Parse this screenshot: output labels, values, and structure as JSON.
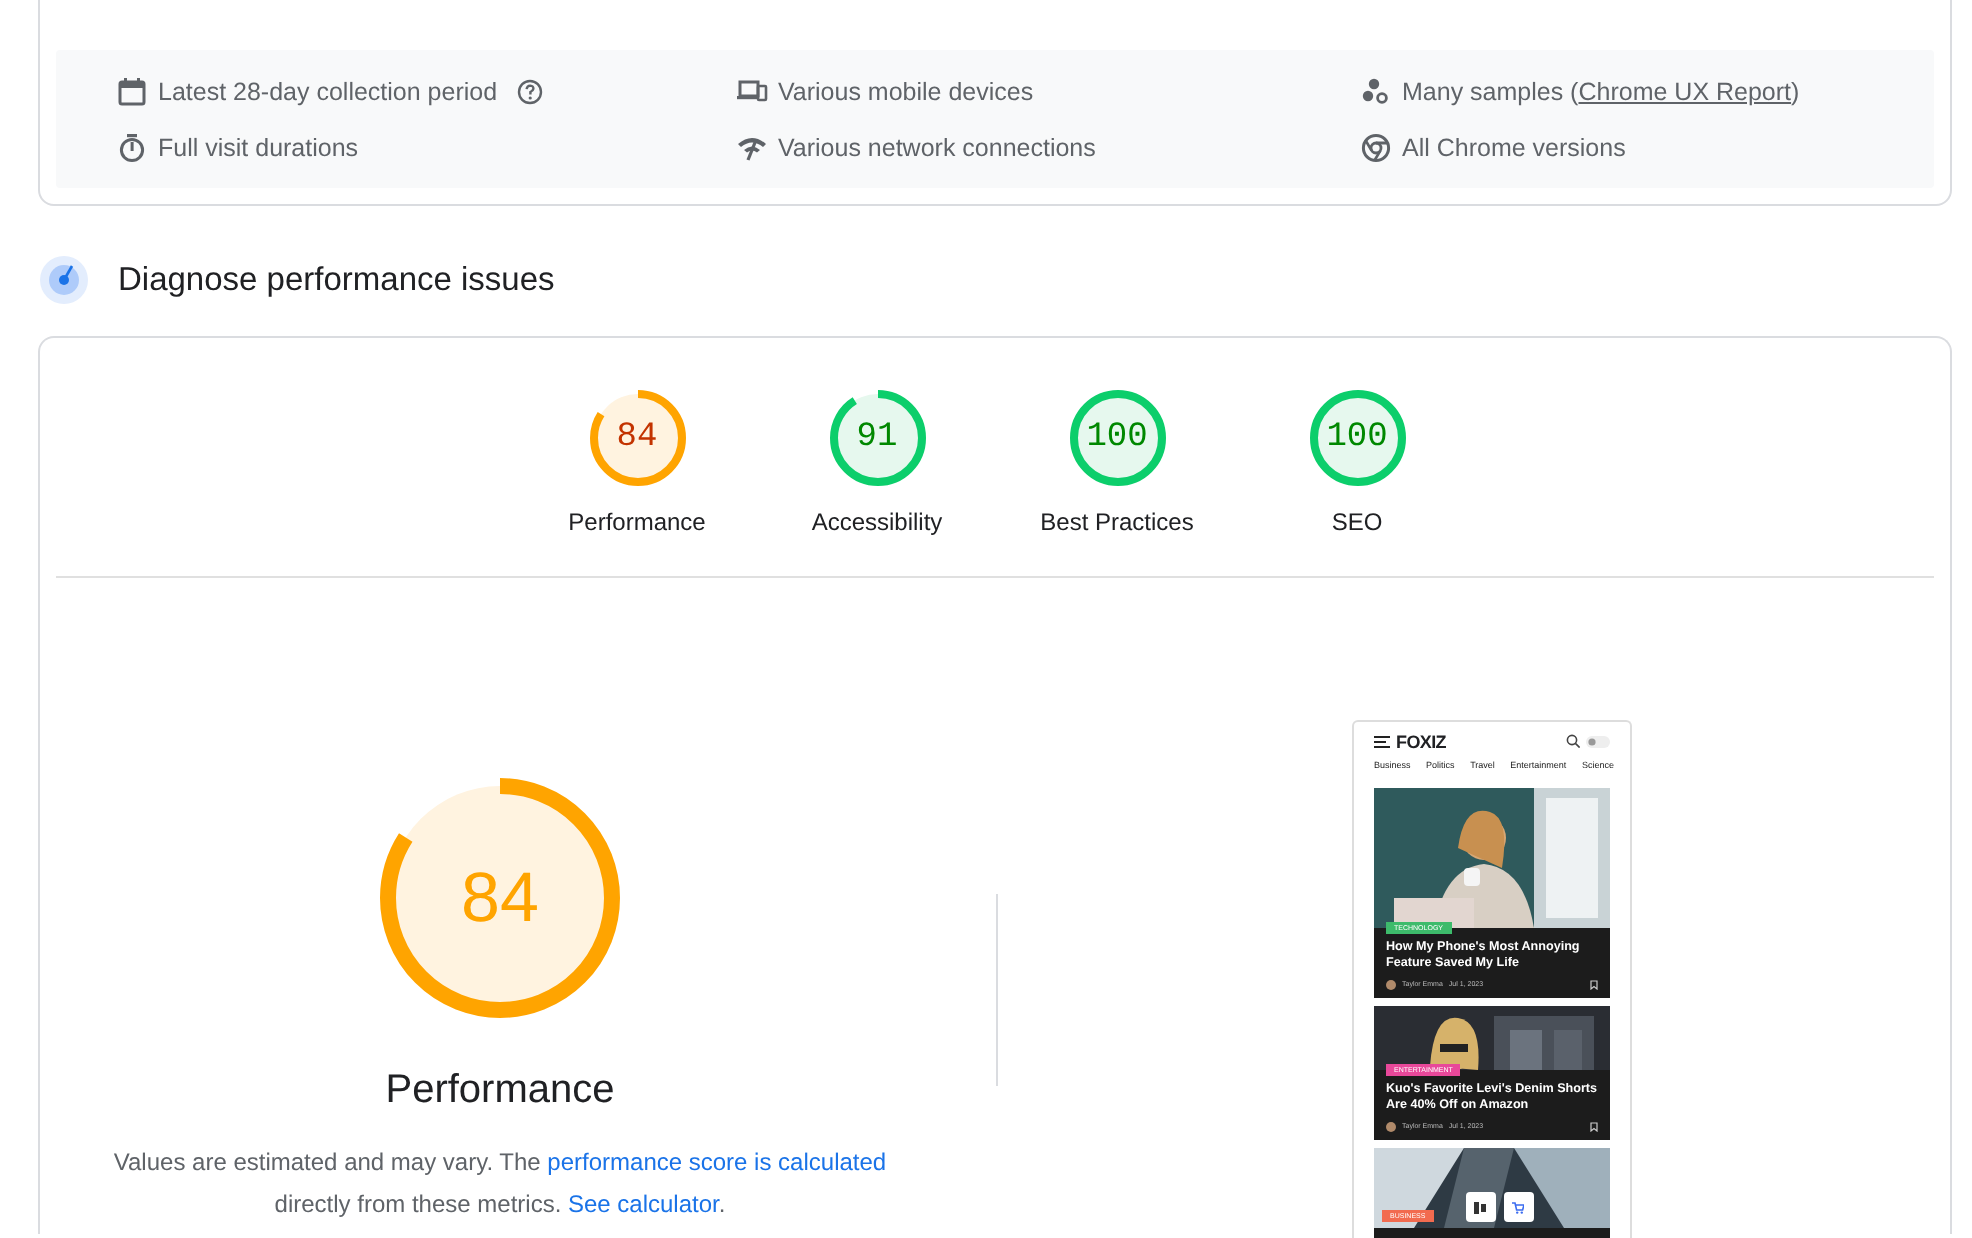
{
  "field_data": {
    "items": [
      {
        "text": "Latest 28-day collection period",
        "help": true
      },
      {
        "text": "Various mobile devices",
        "help": false
      },
      {
        "text": "Many samples (",
        "link": "Chrome UX Report",
        "suffix": ")",
        "help": false
      },
      {
        "text": "Full visit durations",
        "help": false
      },
      {
        "text": "Various network connections",
        "help": false
      },
      {
        "text": "All Chrome versions",
        "help": false
      }
    ]
  },
  "section": {
    "title": "Diagnose performance issues"
  },
  "categories": [
    {
      "score": "84",
      "label": "Performance",
      "level": 0.84
    },
    {
      "score": "91",
      "label": "Accessibility",
      "level": 0.91
    },
    {
      "score": "100",
      "label": "Best Practices",
      "level": 1
    },
    {
      "score": "100",
      "label": "SEO",
      "level": 1
    }
  ],
  "detail": {
    "score": "84",
    "level": 0.84,
    "title": "Performance",
    "note": [
      {
        "kind": "text",
        "text": "Values are estimated and may vary. The "
      },
      {
        "kind": "link",
        "text": "performance score is calculated"
      },
      {
        "kind": "text",
        "text": " directly from these metrics. "
      },
      {
        "kind": "link",
        "text": "See calculator"
      },
      {
        "kind": "text",
        "text": "."
      }
    ]
  },
  "screenshot": {
    "logo": "FOXIZ",
    "nav": [
      "Business",
      "Politics",
      "Travel",
      "Entertainment",
      "Science"
    ],
    "articles": [
      {
        "tag": "TECHNOLOGY",
        "color": "#3dbb6b",
        "title": "How My Phone's Most Annoying Feature Saved My Life",
        "author": "Taylor Emma",
        "date": "Jul 1, 2023"
      },
      {
        "tag": "ENTERTAINMENT",
        "color": "#e8489a",
        "title": "Kuo's Favorite Levi's Denim Shorts Are 40% Off on Amazon",
        "author": "Taylor Emma",
        "date": "Jul 1, 2023"
      },
      {
        "tag": "BUSINESS",
        "color": "#f26b4f"
      }
    ]
  }
}
